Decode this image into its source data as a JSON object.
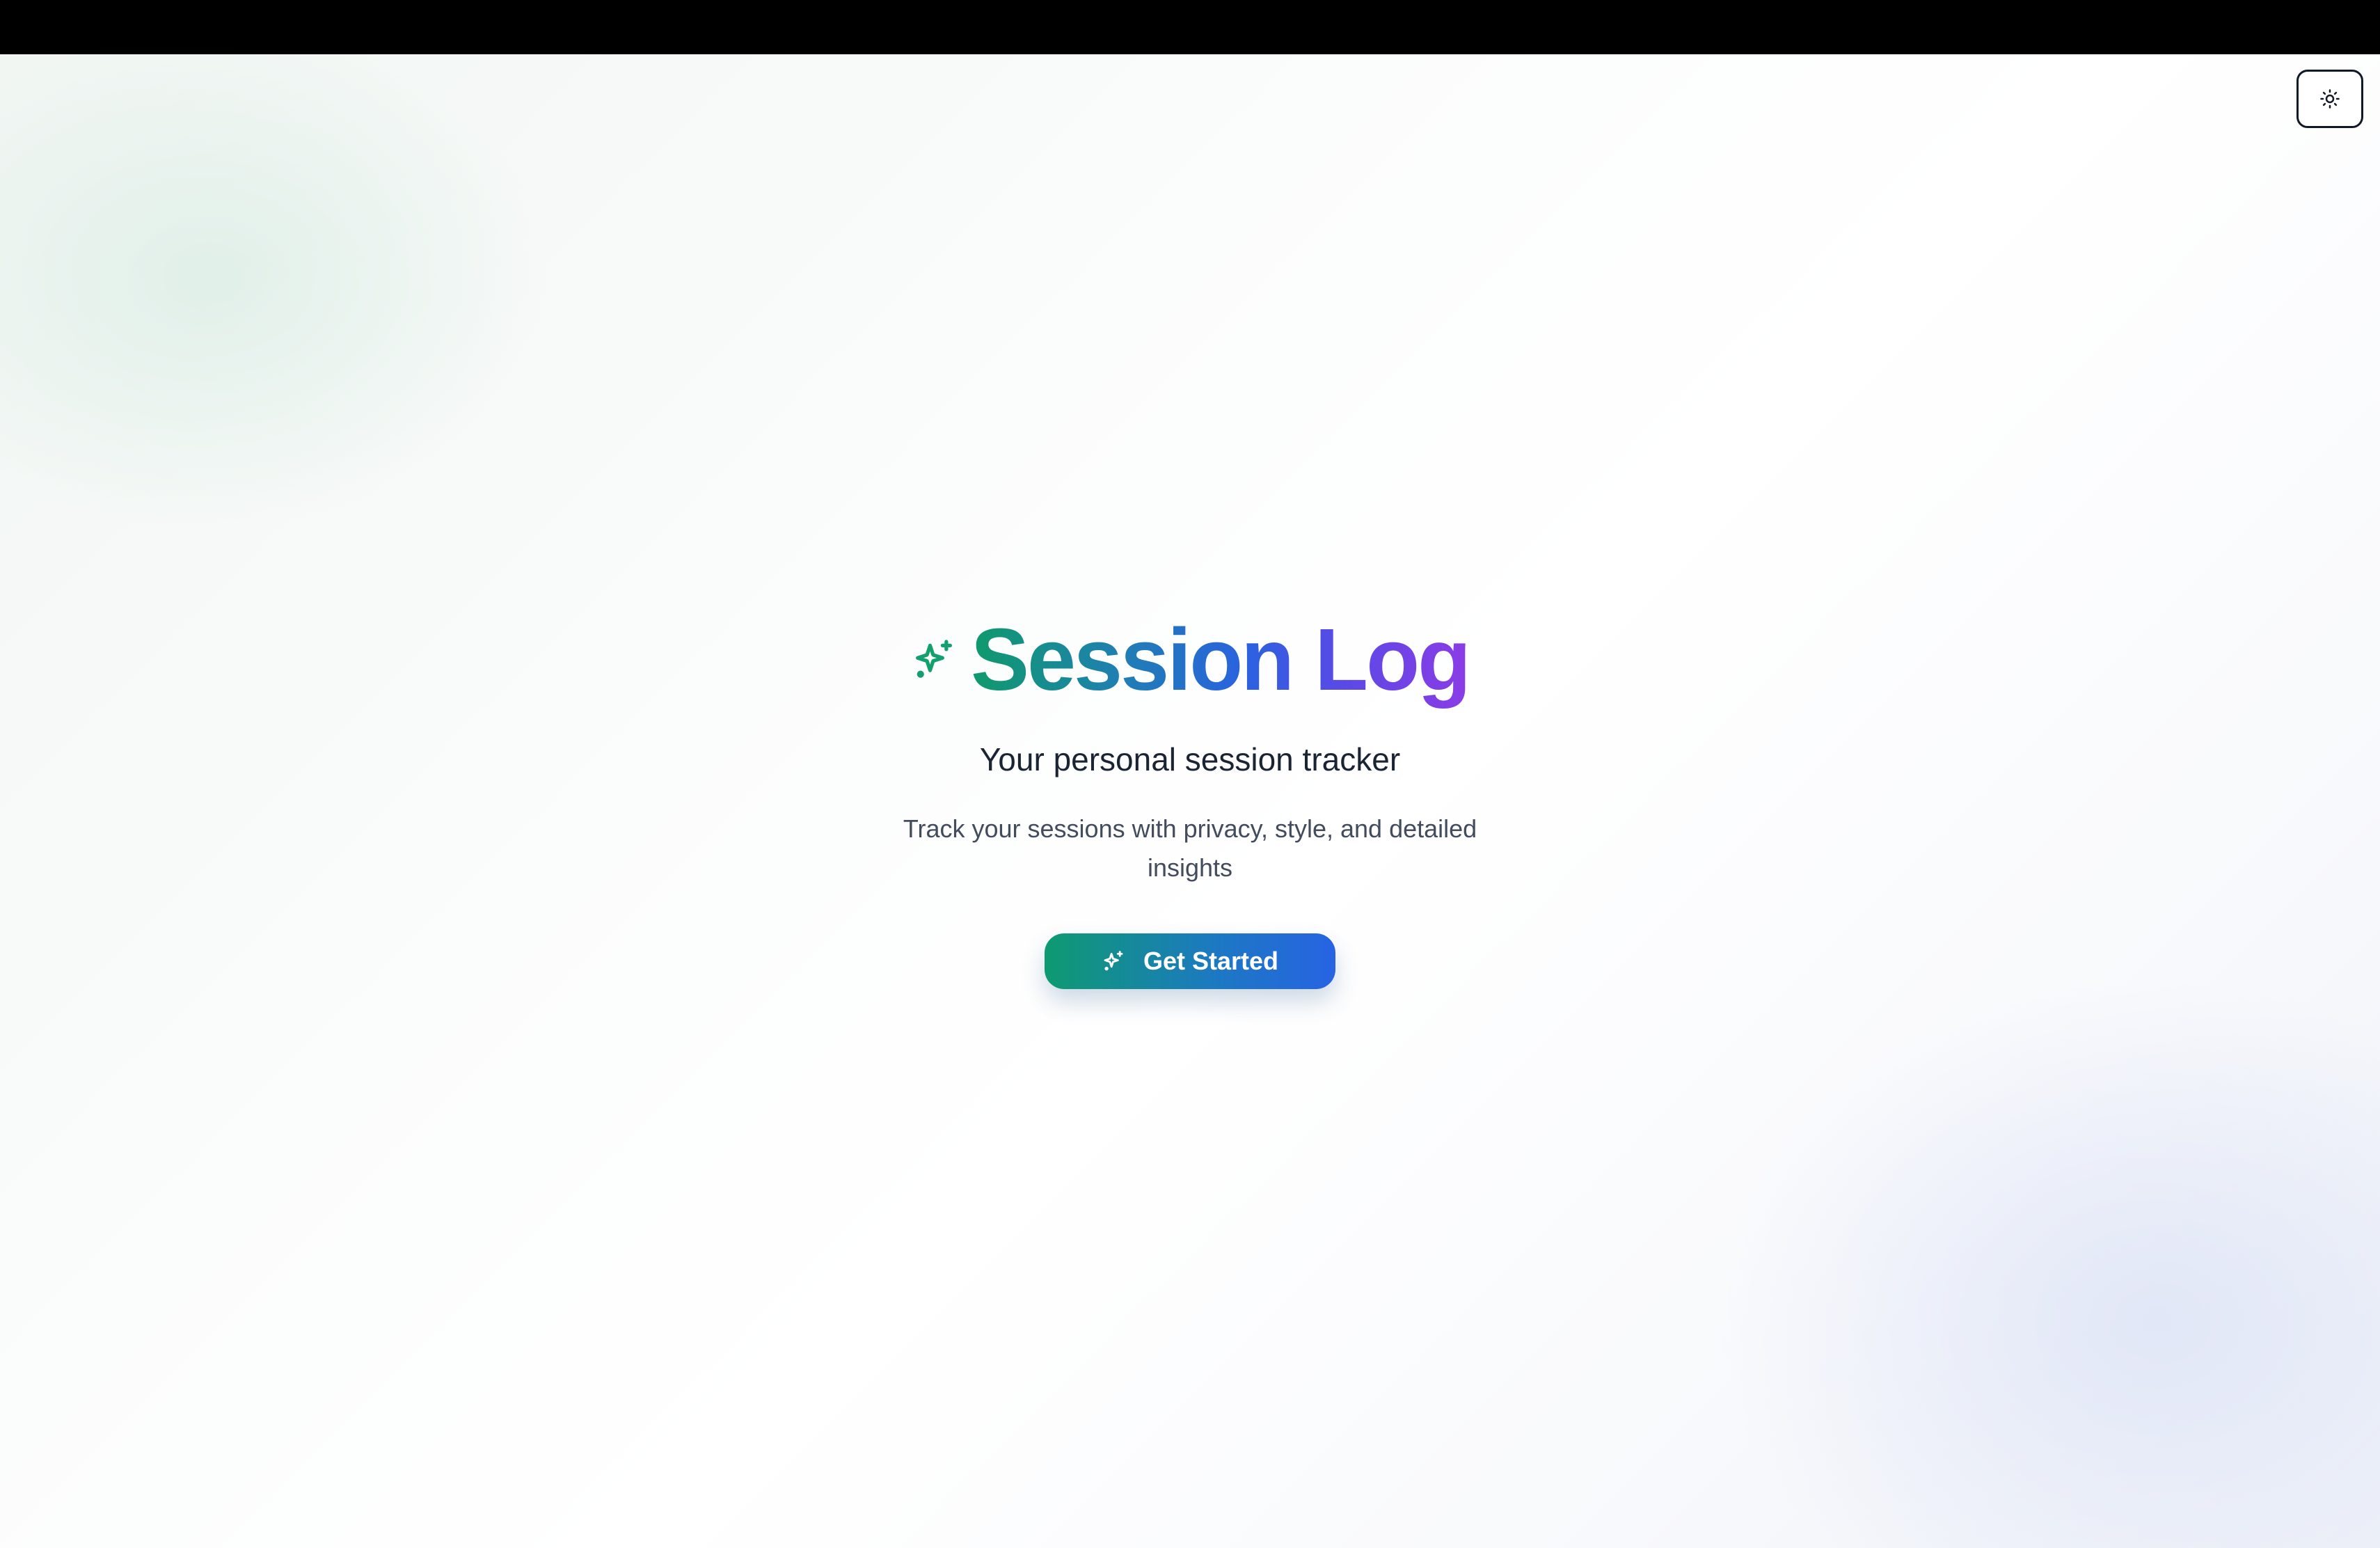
{
  "app": {
    "title": "Session Log",
    "subtitle": "Your personal session tracker",
    "description": "Track your sessions with privacy, style, and detailed insights"
  },
  "cta": {
    "label": "Get Started",
    "icon": "sparkles-icon"
  },
  "theme_toggle": {
    "icon": "sun-icon"
  },
  "colors": {
    "gradient_start": "#0f9a6b",
    "gradient_mid": "#2a62e0",
    "gradient_end": "#8b3ce6",
    "text_dark": "#1b2433",
    "text_muted": "#434c5d"
  }
}
